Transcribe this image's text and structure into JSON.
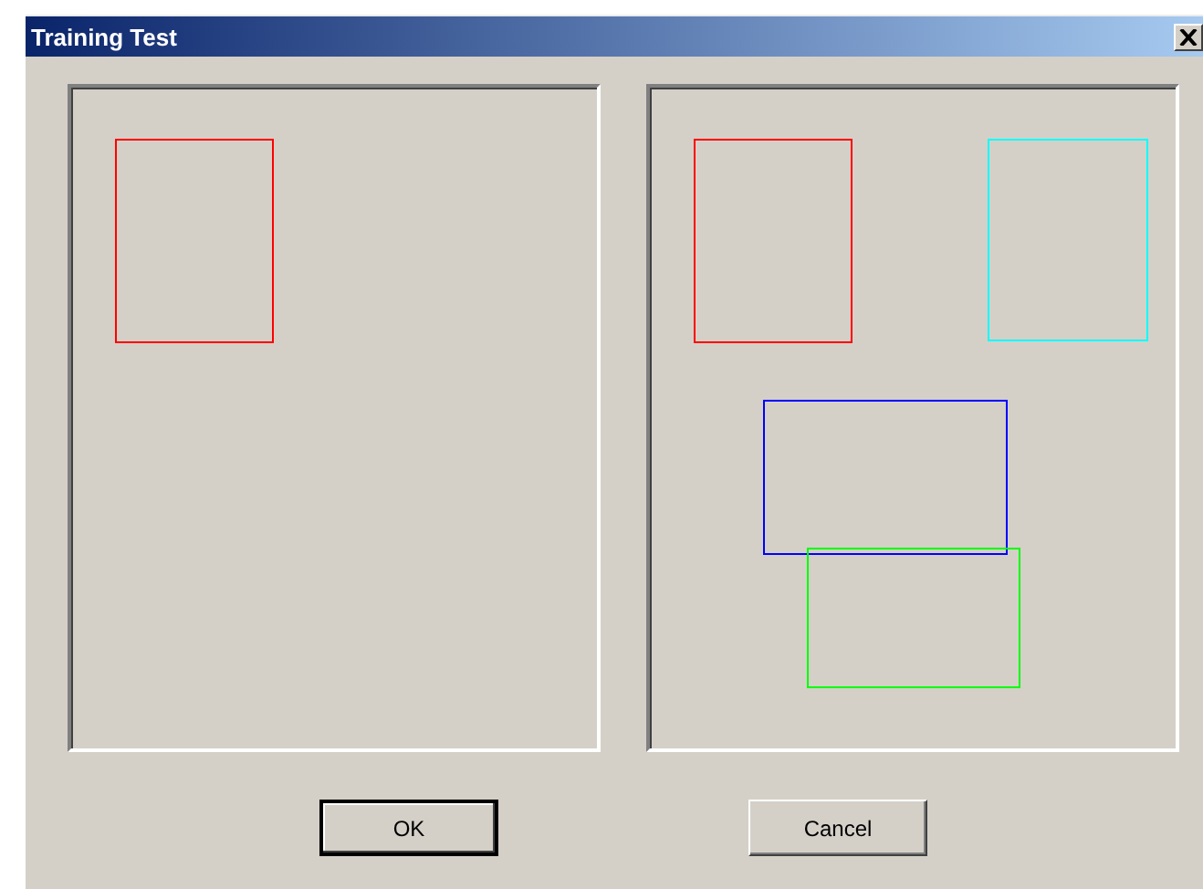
{
  "window": {
    "title": "Training Test"
  },
  "panels": [
    {
      "shapes": [
        {
          "kind": "rectangle",
          "color": "#ff0000"
        }
      ]
    },
    {
      "shapes": [
        {
          "kind": "rectangle",
          "color": "#ff0000"
        },
        {
          "kind": "rectangle",
          "color": "#00ffff"
        },
        {
          "kind": "rectangle",
          "color": "#0000ff"
        },
        {
          "kind": "rectangle",
          "color": "#00ff00"
        }
      ]
    }
  ],
  "buttons": [
    {
      "label": "OK",
      "default": true
    },
    {
      "label": "Cancel",
      "default": false
    }
  ]
}
